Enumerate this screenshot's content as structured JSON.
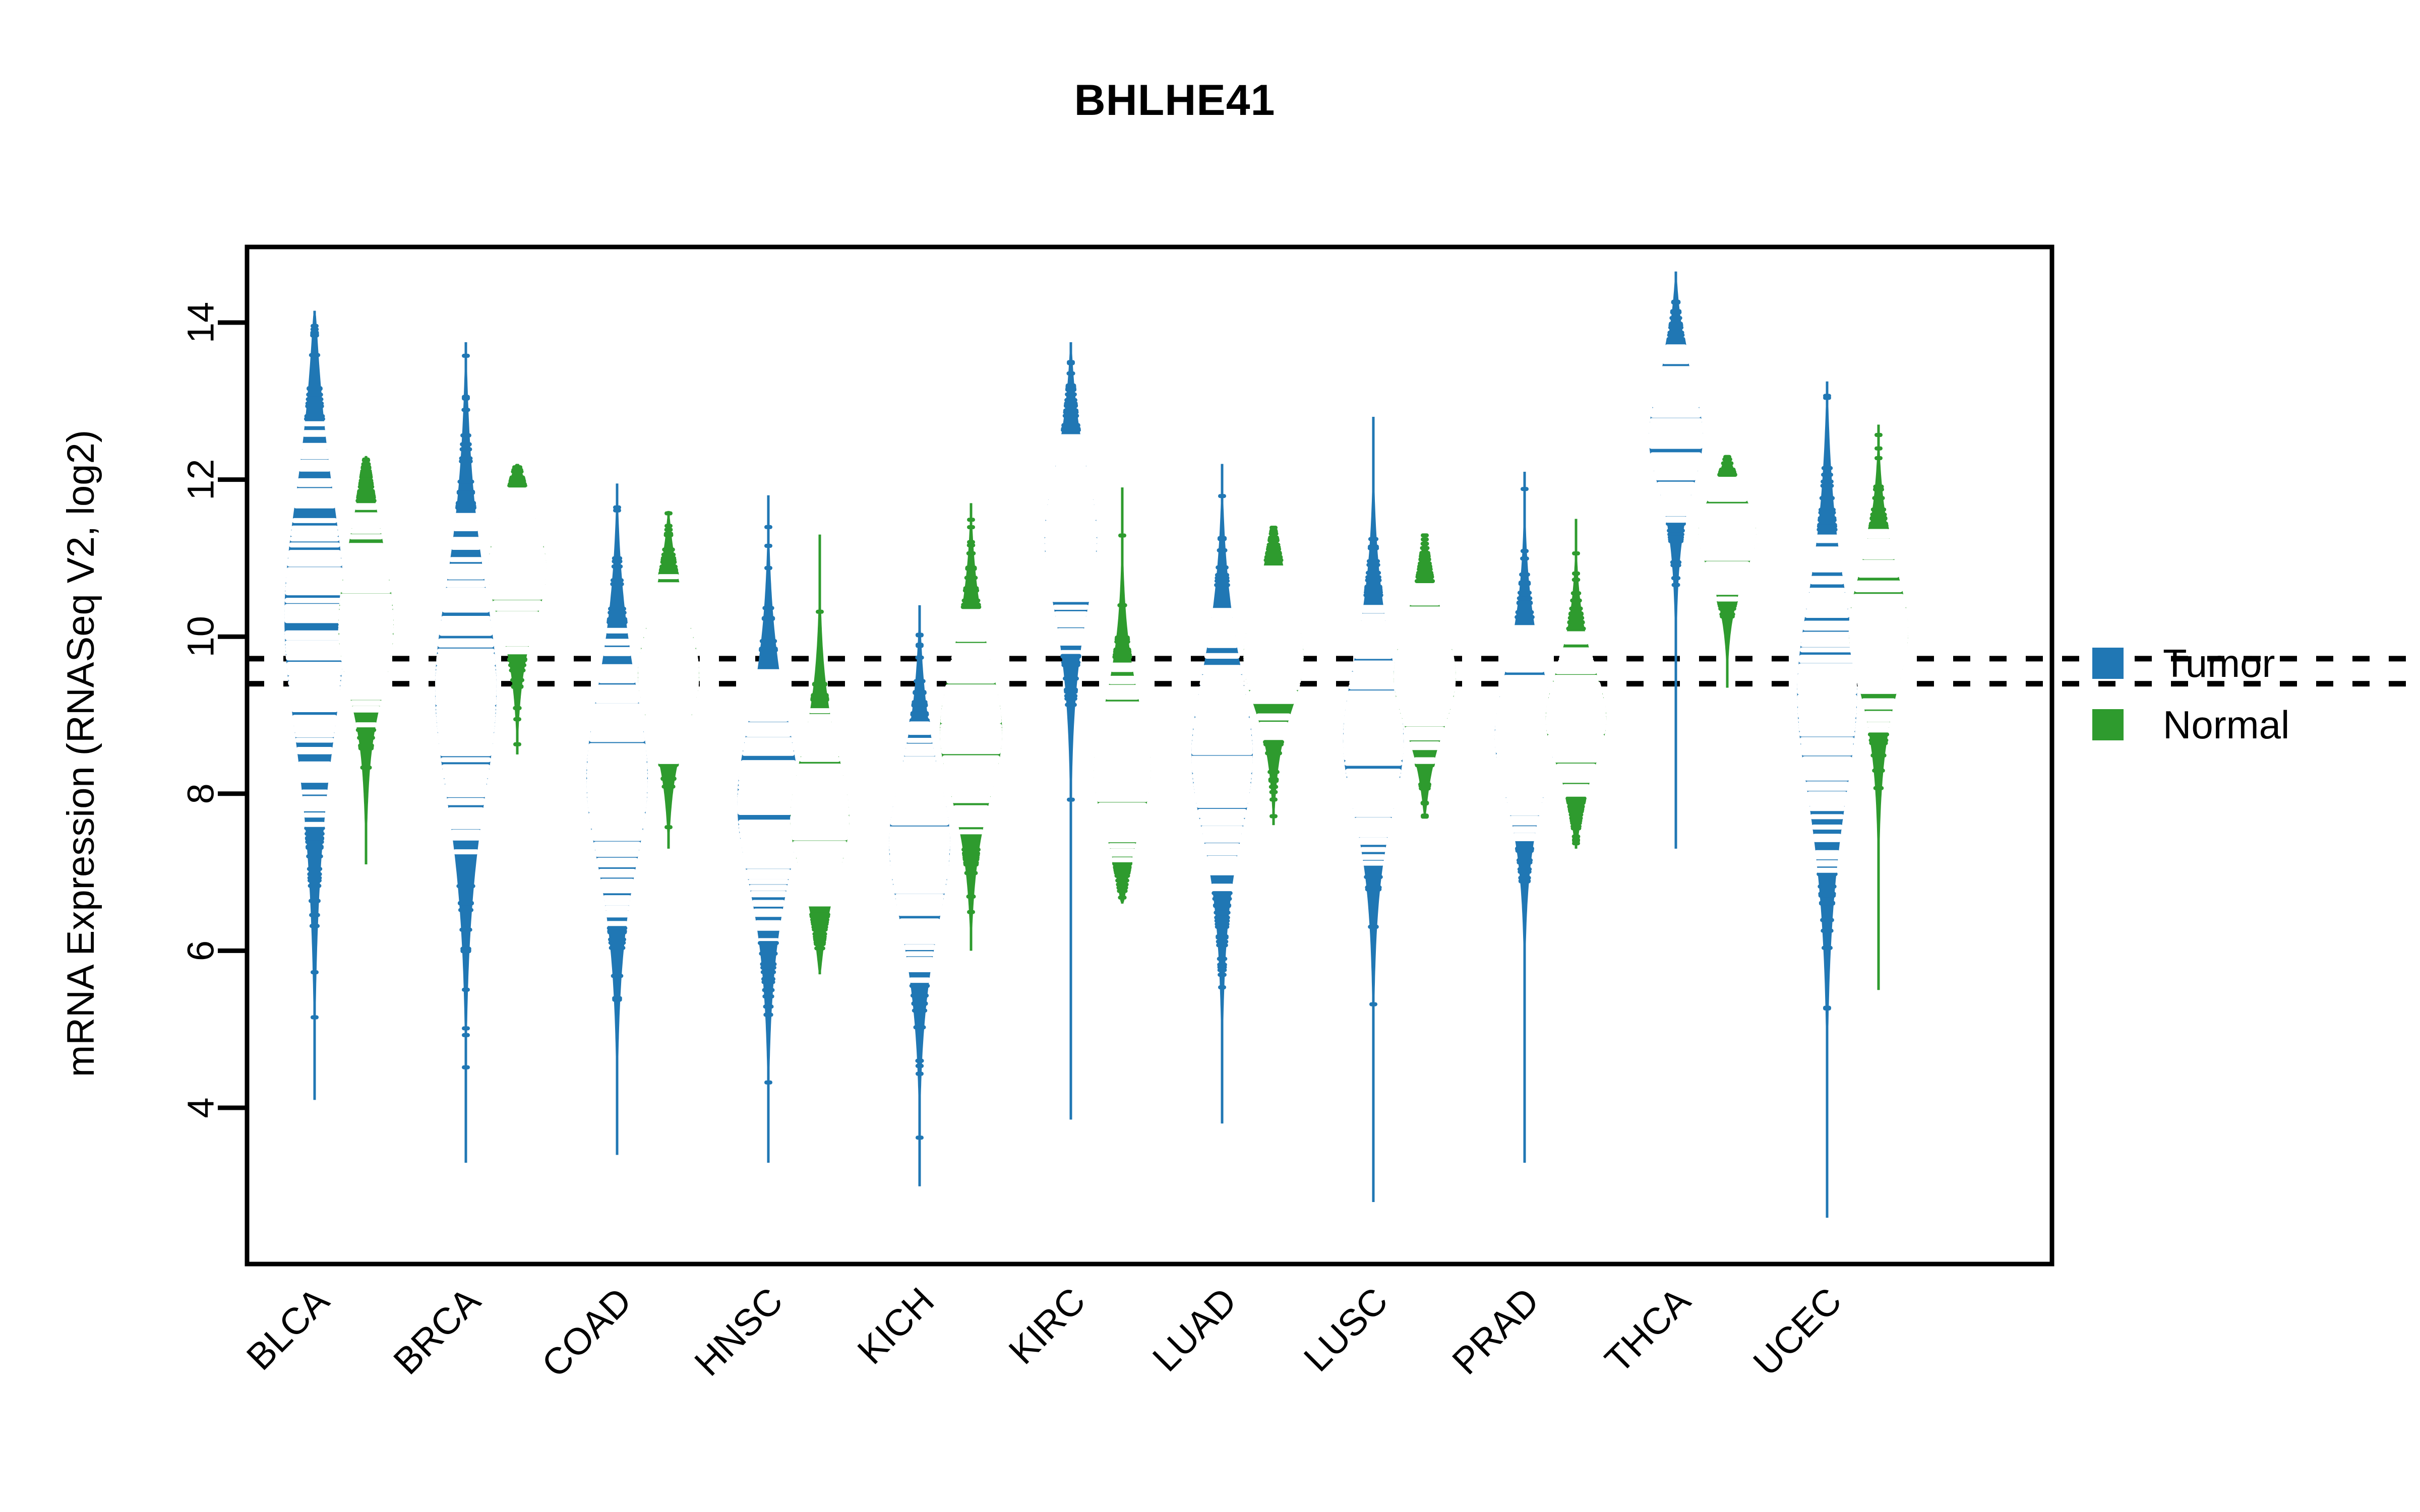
{
  "chart_data": {
    "type": "violin",
    "title": "BHLHE41",
    "xlabel": "",
    "ylabel": "mRNA Expression (RNASeq V2, log2)",
    "ylim": [
      2.6,
      14.9
    ],
    "yticks": [
      4,
      6,
      8,
      10,
      12,
      14
    ],
    "ytick_labels": [
      "4",
      "6",
      "8",
      "10",
      "12",
      "14"
    ],
    "grid": false,
    "legend_position": "right",
    "reference_lines": [
      9.72,
      9.4
    ],
    "categories": [
      "BLCA",
      "BRCA",
      "COAD",
      "HNSC",
      "KICH",
      "KIRC",
      "LUAD",
      "LUSC",
      "PRAD",
      "THCA",
      "UCEC"
    ],
    "series": [
      {
        "name": "Tumor",
        "color": "#2077B4",
        "stats": [
          {
            "category": "BLCA",
            "median": 10.3,
            "min": 4.1,
            "max": 14.15,
            "q1": 9.1,
            "q3": 11.9,
            "peak": 10.5,
            "spread": 2.0
          },
          {
            "category": "BRCA",
            "median": 9.35,
            "min": 3.3,
            "max": 13.75,
            "q1": 8.0,
            "q3": 11.9,
            "peak": 9.4,
            "spread": 1.7
          },
          {
            "category": "COAD",
            "median": 8.1,
            "min": 3.4,
            "max": 11.95,
            "q1": 6.9,
            "q3": 9.7,
            "peak": 8.4,
            "spread": 1.4
          },
          {
            "category": "HNSC",
            "median": 7.85,
            "min": 3.3,
            "max": 11.8,
            "q1": 6.3,
            "q3": 9.4,
            "peak": 8.0,
            "spread": 1.3
          },
          {
            "category": "KICH",
            "median": 7.5,
            "min": 3.0,
            "max": 10.4,
            "q1": 6.2,
            "q3": 8.6,
            "peak": 7.3,
            "spread": 1.2
          },
          {
            "category": "KIRC",
            "median": 11.35,
            "min": 3.85,
            "max": 13.75,
            "q1": 10.5,
            "q3": 12.2,
            "peak": 11.4,
            "spread": 1.1
          },
          {
            "category": "LUAD",
            "median": 8.4,
            "min": 3.8,
            "max": 12.2,
            "q1": 7.1,
            "q3": 9.7,
            "peak": 8.7,
            "spread": 1.3
          },
          {
            "category": "LUSC",
            "median": 8.6,
            "min": 2.8,
            "max": 12.8,
            "q1": 7.3,
            "q3": 10.1,
            "peak": 8.9,
            "spread": 1.2
          },
          {
            "category": "PRAD",
            "median": 8.7,
            "min": 3.3,
            "max": 12.1,
            "q1": 8.0,
            "q3": 9.9,
            "peak": 8.9,
            "spread": 1.0
          },
          {
            "category": "THCA",
            "median": 12.5,
            "min": 7.3,
            "max": 14.65,
            "q1": 11.9,
            "q3": 13.35,
            "peak": 12.8,
            "spread": 0.85
          },
          {
            "category": "UCEC",
            "median": 9.4,
            "min": 2.6,
            "max": 13.25,
            "q1": 8.2,
            "q3": 11.1,
            "peak": 9.3,
            "spread": 1.6
          }
        ]
      },
      {
        "name": "Normal",
        "color": "#2E9B2E",
        "stats": [
          {
            "category": "BLCA",
            "median": 9.85,
            "min": 7.1,
            "max": 12.3,
            "q1": 9.2,
            "q3": 10.9,
            "peak": 10.7,
            "spread": 1.1
          },
          {
            "category": "BRCA",
            "median": 10.85,
            "min": 8.5,
            "max": 12.2,
            "q1": 10.3,
            "q3": 11.5,
            "peak": 11.1,
            "spread": 0.9
          },
          {
            "category": "COAD",
            "median": 9.4,
            "min": 7.3,
            "max": 11.6,
            "q1": 8.9,
            "q3": 9.9,
            "peak": 9.7,
            "spread": 0.9
          },
          {
            "category": "HNSC",
            "median": 7.6,
            "min": 5.7,
            "max": 11.3,
            "q1": 7.2,
            "q3": 8.4,
            "peak": 7.6,
            "spread": 1.0
          },
          {
            "category": "KICH",
            "median": 8.7,
            "min": 6.0,
            "max": 11.7,
            "q1": 8.2,
            "q3": 9.4,
            "peak": 8.9,
            "spread": 1.1
          },
          {
            "category": "KIRC",
            "median": 8.15,
            "min": 6.6,
            "max": 11.9,
            "q1": 7.7,
            "q3": 8.7,
            "peak": 8.2,
            "spread": 1.0
          },
          {
            "category": "LUAD",
            "median": 9.65,
            "min": 7.6,
            "max": 11.4,
            "q1": 9.2,
            "q3": 10.3,
            "peak": 10.0,
            "spread": 0.9
          },
          {
            "category": "LUSC",
            "median": 9.4,
            "min": 7.7,
            "max": 11.3,
            "q1": 9.1,
            "q3": 10.0,
            "peak": 9.6,
            "spread": 0.9
          },
          {
            "category": "PRAD",
            "median": 8.9,
            "min": 7.3,
            "max": 11.5,
            "q1": 8.5,
            "q3": 9.3,
            "peak": 8.9,
            "spread": 0.8
          },
          {
            "category": "THCA",
            "median": 11.4,
            "min": 9.35,
            "max": 12.3,
            "q1": 11.0,
            "q3": 11.8,
            "peak": 11.4,
            "spread": 0.65
          },
          {
            "category": "UCEC",
            "median": 10.1,
            "min": 5.5,
            "max": 12.7,
            "q1": 9.5,
            "q3": 10.5,
            "peak": 10.2,
            "spread": 0.95
          }
        ]
      }
    ]
  },
  "title": {
    "text": "BHLHE41"
  },
  "axes": {
    "ylabel": "mRNA Expression (RNASeq V2, log2)",
    "ytick_labels": [
      "4",
      "6",
      "8",
      "10",
      "12",
      "14"
    ],
    "xtick_labels": [
      "BLCA",
      "BRCA",
      "COAD",
      "HNSC",
      "KICH",
      "KIRC",
      "LUAD",
      "LUSC",
      "PRAD",
      "THCA",
      "UCEC"
    ]
  },
  "legend": {
    "items": [
      {
        "label": "Tumor",
        "color": "#2077B4",
        "swatch": "square-swatch"
      },
      {
        "label": "Normal",
        "color": "#2E9B2E",
        "swatch": "square-swatch"
      }
    ]
  },
  "colors": {
    "tumor": "#2077B4",
    "normal": "#2E9B2E",
    "axis": "#000000",
    "background": "#FFFFFF"
  }
}
